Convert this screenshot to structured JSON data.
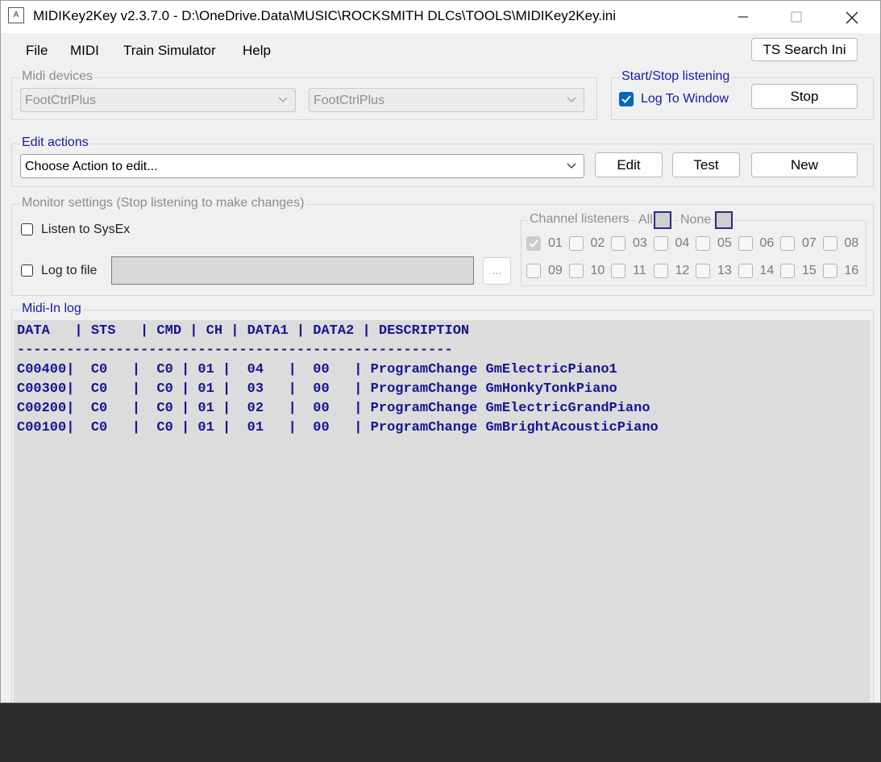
{
  "window": {
    "title": "MIDIKey2Key v2.3.7.0 - D:\\OneDrive.Data\\MUSIC\\ROCKSMITH DLCs\\TOOLS\\MIDIKey2Key.ini",
    "icon_letter": "A"
  },
  "menu": {
    "items": [
      "File",
      "MIDI",
      "Train Simulator",
      "Help"
    ],
    "ts_search_ini": "TS Search Ini"
  },
  "midi_devices": {
    "legend": "Midi devices",
    "input_device": "FootCtrlPlus",
    "output_device": "FootCtrlPlus"
  },
  "start_stop": {
    "legend": "Start/Stop listening",
    "log_to_window": "Log To Window",
    "log_to_window_checked": true,
    "stop_label": "Stop"
  },
  "edit_actions": {
    "legend": "Edit actions",
    "placeholder": "Choose Action to edit...",
    "edit_label": "Edit",
    "test_label": "Test",
    "new_label": "New"
  },
  "monitor": {
    "legend": "Monitor settings (Stop listening to make changes)",
    "listen_sysex": "Listen to SysEx",
    "log_to_file": "Log to file",
    "browse_label": "...",
    "channel_legend": "Channel listeners",
    "all_label": "All",
    "none_label": "None",
    "channels": [
      "01",
      "02",
      "03",
      "04",
      "05",
      "06",
      "07",
      "08",
      "09",
      "10",
      "11",
      "12",
      "13",
      "14",
      "15",
      "16"
    ],
    "checked_channel": "01"
  },
  "log": {
    "legend": "Midi-In log",
    "lines": [
      "DATA   | STS   | CMD | CH | DATA1 | DATA2 | DESCRIPTION",
      "-----------------------------------------------------",
      "C00400|  C0   |  C0 | 01 |  04   |  00   | ProgramChange GmElectricPiano1",
      "C00300|  C0   |  C0 | 01 |  03   |  00   | ProgramChange GmHonkyTonkPiano",
      "C00200|  C0   |  C0 | 01 |  02   |  00   | ProgramChange GmElectricGrandPiano",
      "C00100|  C0   |  C0 | 01 |  01   |  00   | ProgramChange GmBrightAcousticPiano"
    ]
  },
  "colors": {
    "accent": "#0067c0",
    "legend_blue": "#1a1aa0",
    "log_text": "#151590",
    "log_bg": "#dcdcdc"
  }
}
